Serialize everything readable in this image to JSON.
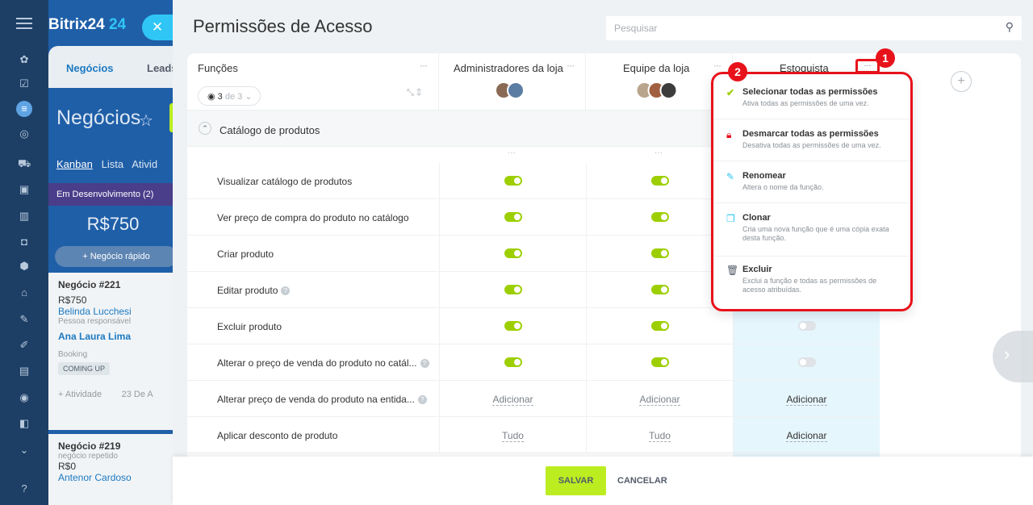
{
  "crm": {
    "logo": "Bitrix24",
    "logo_suffix": "24",
    "tabs": [
      "Negócios",
      "Leads"
    ],
    "title": "Negócios",
    "views": [
      "Kanban",
      "Lista",
      "Ativid"
    ],
    "stage": "Em Desenvolvimento (2)",
    "stage_sum": "R$750",
    "quick_add": "+ Negócio rápido",
    "cards": [
      {
        "name": "Negócio #221",
        "amount": "R$750",
        "client": "Belinda Lucchesi",
        "role": "Pessoa responsável",
        "owner": "Ana Laura Lima",
        "status": "Booking",
        "badge": "COMING UP",
        "activity": "+ Atividade",
        "date": "23 De A"
      },
      {
        "name": "Negócio #219",
        "note": "negócio repetido",
        "amount": "R$0",
        "client": "Antenor Cardoso"
      }
    ]
  },
  "panel": {
    "title": "Permissões de Acesso",
    "search_placeholder": "Pesquisar",
    "functions_label": "Funções",
    "pill_count": "3",
    "pill_of": "de 3",
    "columns": [
      {
        "label": "Administradores da loja"
      },
      {
        "label": "Equipe da loja"
      },
      {
        "label": "Estoquista"
      }
    ],
    "section": "Catálogo de produtos",
    "rows": [
      {
        "label": "Visualizar catálogo de produtos"
      },
      {
        "label": "Ver preço de compra do produto no catálogo"
      },
      {
        "label": "Criar produto"
      },
      {
        "label": "Editar produto"
      },
      {
        "label": "Excluir produto"
      },
      {
        "label": "Alterar o preço de venda do produto no catál..."
      },
      {
        "label": "Alterar preço de venda do produto na entida...",
        "c1": "Adicionar",
        "c2": "Adicionar",
        "c3": "Adicionar"
      },
      {
        "label": "Aplicar desconto de produto",
        "c1": "Tudo",
        "c2": "Tudo",
        "c3": "Adicionar"
      }
    ],
    "save": "SALVAR",
    "cancel": "CANCELAR"
  },
  "menu": {
    "items": [
      {
        "title": "Selecionar todas as permissões",
        "desc": "Ativa todas as permissões de uma vez."
      },
      {
        "title": "Desmarcar todas as permissões",
        "desc": "Desativa todas as permissões de uma vez."
      },
      {
        "title": "Renomear",
        "desc": "Altera o nome da função."
      },
      {
        "title": "Clonar",
        "desc": "Cria uma nova função que é uma cópia exata desta função."
      },
      {
        "title": "Excluir",
        "desc": "Exclui a função e todas as permissões de acesso atribuídas."
      }
    ]
  },
  "markers": [
    "1",
    "2"
  ],
  "colors": {
    "accent": "#2fc6f6",
    "toggle_on": "#9dcf00",
    "save_btn": "#bbed21",
    "highlight": "#e8121b"
  }
}
